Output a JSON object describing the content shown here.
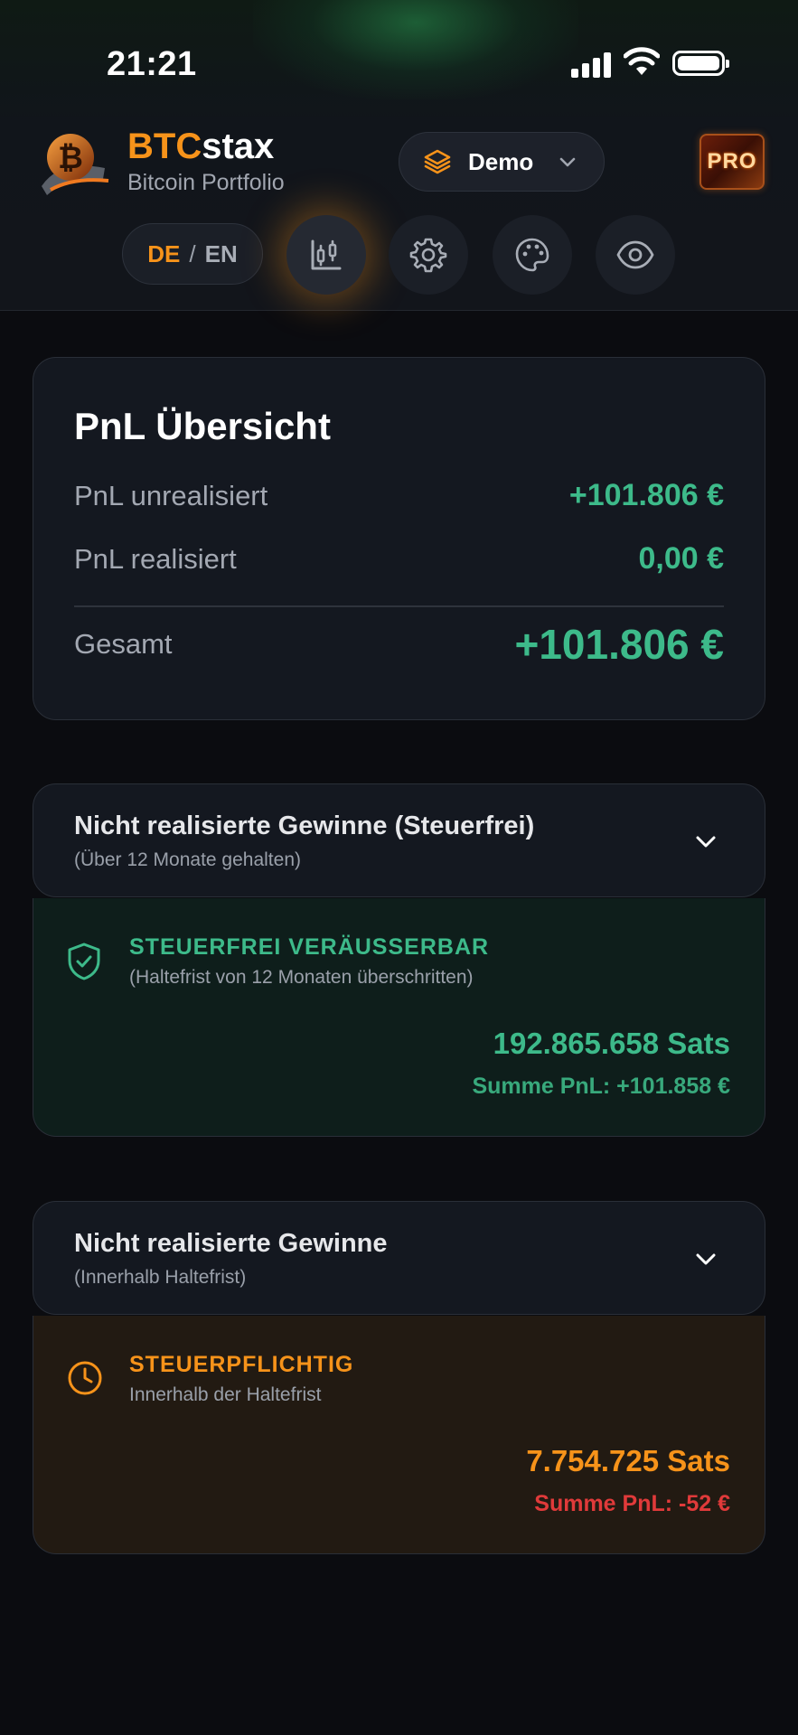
{
  "status_bar": {
    "time": "21:21"
  },
  "brand": {
    "title_part1": "BTC",
    "title_part2": "stax",
    "subtitle": "Bitcoin Portfolio"
  },
  "portfolio_selector": {
    "label": "Demo"
  },
  "pro_badge": {
    "label": "PRO"
  },
  "language": {
    "active": "DE",
    "separator": "/",
    "inactive": "EN"
  },
  "toolbar": {
    "icons": [
      "chart-candlestick-icon",
      "gear-icon",
      "palette-icon",
      "eye-icon"
    ],
    "active": "chart-candlestick-icon"
  },
  "pnl_overview": {
    "title": "PnL Übersicht",
    "rows": [
      {
        "label": "PnL unrealisiert",
        "value": "+101.806 €"
      },
      {
        "label": "PnL realisiert",
        "value": "0,00 €"
      }
    ],
    "total": {
      "label": "Gesamt",
      "value": "+101.806 €"
    }
  },
  "taxfree_section": {
    "title": "Nicht realisierte Gewinne (Steuerfrei)",
    "subtitle": "(Über 12 Monate gehalten)",
    "panel": {
      "badge": "STEUERFREI VERÄUSSERBAR",
      "note": "(Haltefrist von 12 Monaten überschritten)",
      "amount": "192.865.658 Sats",
      "sum": "Summe PnL: +101.858 €"
    }
  },
  "taxable_section": {
    "title": "Nicht realisierte Gewinne",
    "subtitle": "(Innerhalb Haltefrist)",
    "panel": {
      "badge": "STEUERPFLICHTIG",
      "note": "Innerhalb der Haltefrist",
      "amount": "7.754.725 Sats",
      "sum": "Summe PnL: -52 €"
    }
  },
  "colors": {
    "accent": "#f7931a",
    "positive": "#3dba8a",
    "negative": "#e03a3a",
    "background": "#0b0c10",
    "card": "#141820"
  }
}
